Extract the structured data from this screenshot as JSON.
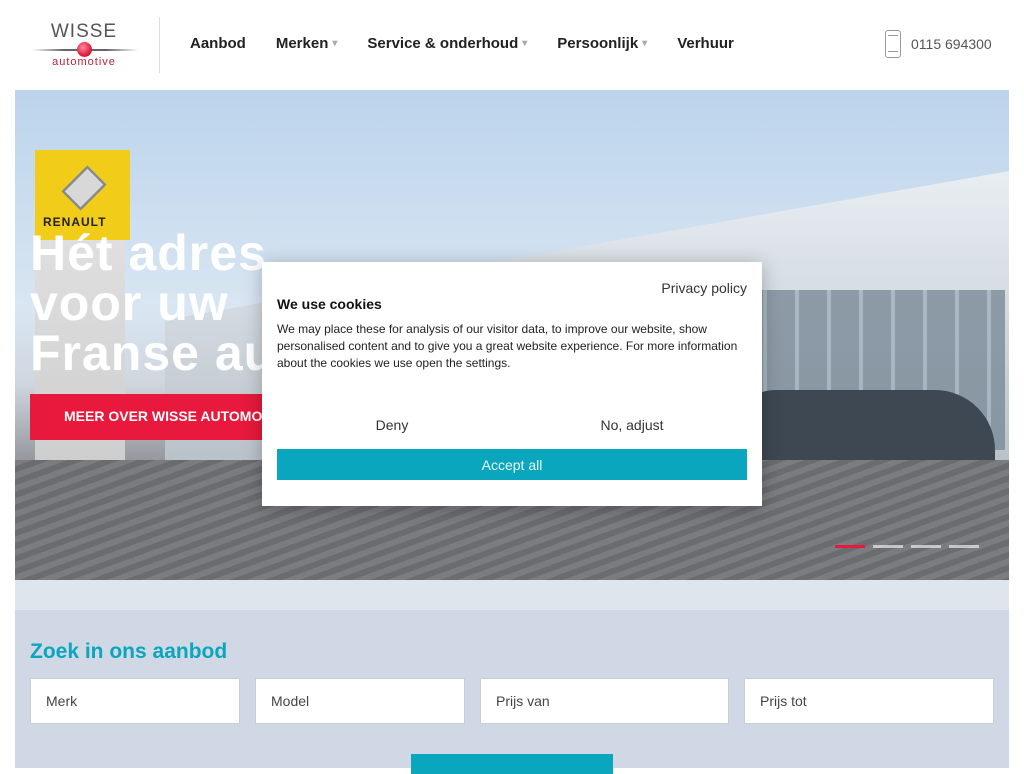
{
  "logo": {
    "top": "WISSE",
    "bottom": "automotive"
  },
  "nav": {
    "items": [
      {
        "label": "Aanbod",
        "dropdown": false
      },
      {
        "label": "Merken",
        "dropdown": true
      },
      {
        "label": "Service & onderhoud",
        "dropdown": true
      },
      {
        "label": "Persoonlijk",
        "dropdown": true
      },
      {
        "label": "Verhuur",
        "dropdown": false
      }
    ],
    "caret": "▾"
  },
  "phone": {
    "number": "0115 694300"
  },
  "hero": {
    "title_lines": [
      "Hét adres",
      "voor uw",
      "Franse au"
    ],
    "sign_text": "RENAULT",
    "cta": "MEER OVER WISSE AUTOMOTIVE",
    "slides": 4,
    "active_slide": 1
  },
  "search": {
    "title": "Zoek in ons aanbod",
    "fields": [
      "Merk",
      "Model",
      "Prijs van",
      "Prijs tot"
    ]
  },
  "cookie": {
    "privacy": "Privacy policy",
    "title": "We use cookies",
    "body": "We may place these for analysis of our visitor data, to improve our website, show personalised content and to give you a great website experience. For more information about the cookies we use open the settings.",
    "deny": "Deny",
    "adjust": "No, adjust",
    "accept": "Accept all"
  },
  "colors": {
    "accent_red": "#e8193c",
    "accent_teal": "#0aa6bd"
  }
}
